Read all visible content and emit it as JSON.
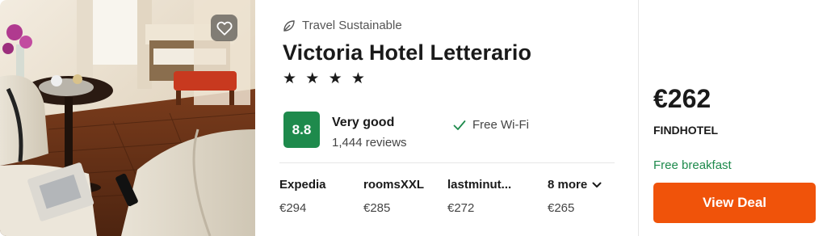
{
  "photo": {
    "alt_icon": "hotel-room-photo"
  },
  "favorite": {
    "icon": "heart-outline-icon"
  },
  "hotel": {
    "badge_label": "Travel Sustainable",
    "name": "Victoria Hotel Letterario",
    "stars_text": "★ ★ ★ ★",
    "star_count": 4
  },
  "rating": {
    "score": "8.8",
    "label": "Very good",
    "reviews": "1,444 reviews",
    "color": "#1e8a4c"
  },
  "amenity": {
    "label": "Free Wi-Fi",
    "icon": "checkmark-icon"
  },
  "providers": [
    {
      "name": "Expedia",
      "price": "€294"
    },
    {
      "name": "roomsXXL",
      "price": "€285"
    },
    {
      "name": "lastminut...",
      "price": "€272"
    },
    {
      "name": "8 more",
      "price": "€265"
    }
  ],
  "deal": {
    "price": "€262",
    "provider": "FINDHOTEL",
    "perk": "Free breakfast",
    "button_label": "View Deal",
    "button_color": "#f0530a"
  }
}
